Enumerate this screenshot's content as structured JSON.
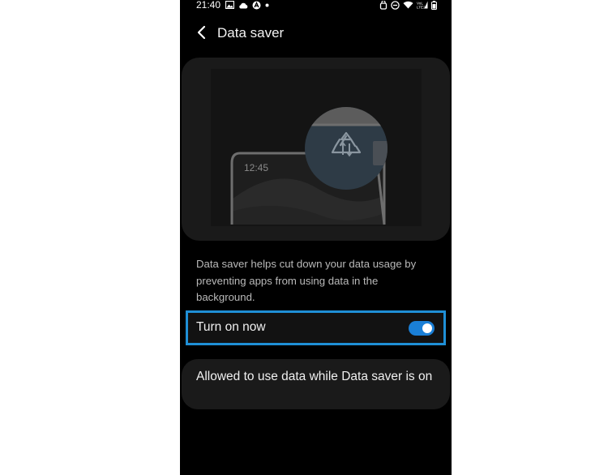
{
  "statusbar": {
    "time": "21:40",
    "left_icons": [
      "gallery-icon",
      "cloud-icon",
      "app-notification-icon",
      "dot-icon"
    ],
    "right_icons": [
      "alarm-icon",
      "no-disturb-icon",
      "wifi-icon",
      "volte-signal-icon",
      "battery-icon"
    ]
  },
  "appbar": {
    "back_icon": "chevron-left-icon",
    "title": "Data saver"
  },
  "illustration": {
    "clock_text": "12:45",
    "badge_icon": "data-saver-icon"
  },
  "description": "Data saver helps cut down your data usage by preventing apps from using data in the background.",
  "toggle": {
    "label": "Turn on now",
    "state": "on",
    "accent_color": "#1a7fd6",
    "highlight_color": "#1f8fd6"
  },
  "allowed": {
    "label": "Allowed to use data while Data saver is on"
  }
}
